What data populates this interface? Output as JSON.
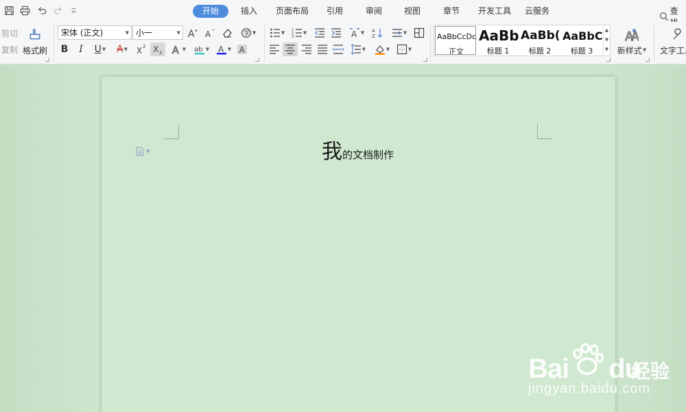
{
  "quick_access": {
    "icons": [
      "save-icon",
      "print-icon",
      "undo-icon",
      "redo-icon",
      "customize-icon"
    ]
  },
  "tabs": [
    {
      "label": "开始",
      "active": true
    },
    {
      "label": "插入"
    },
    {
      "label": "页面布局"
    },
    {
      "label": "引用"
    },
    {
      "label": "审阅"
    },
    {
      "label": "视图"
    },
    {
      "label": "章节"
    },
    {
      "label": "开发工具"
    },
    {
      "label": "云服务"
    }
  ],
  "search_label": "查找",
  "clipboard": {
    "cut": "剪切",
    "copy": "复制",
    "format_painter": "格式刷"
  },
  "font": {
    "name": "宋体 (正文)",
    "size": "小一"
  },
  "styles": [
    {
      "preview": "AaBbCcDd",
      "name": "正文"
    },
    {
      "preview": "AaBb",
      "name": "标题 1"
    },
    {
      "preview": "AaBb(",
      "name": "标题 2"
    },
    {
      "preview": "AaBbC",
      "name": "标题 3"
    }
  ],
  "new_style": "新样式",
  "text_tools": "文字工具",
  "document": {
    "big_char": "我",
    "rest_text": "的文档制作"
  },
  "watermark": {
    "brand": "Bai",
    "brand2": "du",
    "cn": "经验",
    "url": "jingyan.baidu.com"
  },
  "colors": {
    "accent": "#4e8bdc",
    "page": "#cfe8cf",
    "workspace": "#cde5cd",
    "highlight_bar": "#3fc8c8",
    "font_color_bar": "#2020ff",
    "shade_bar": "#ff8c00"
  }
}
